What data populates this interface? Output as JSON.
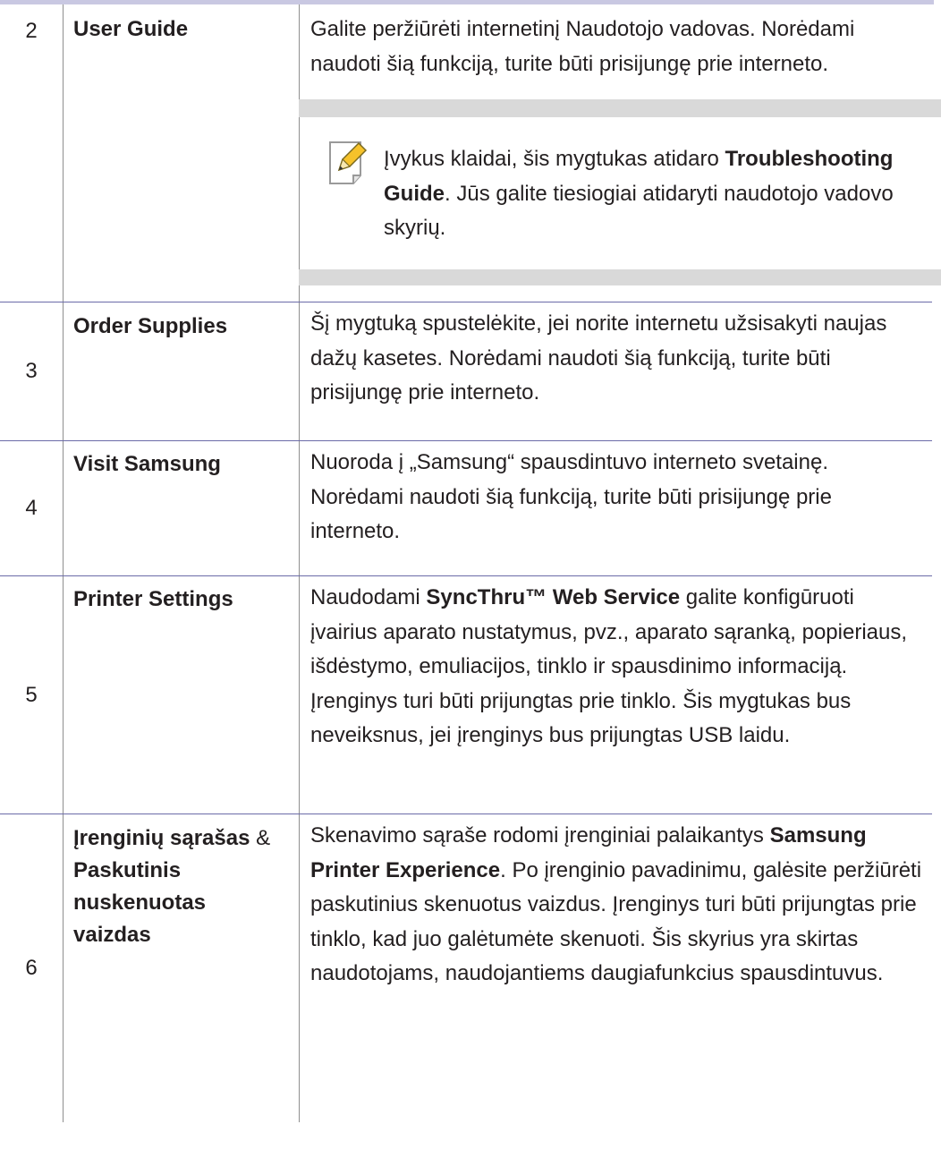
{
  "rows": [
    {
      "num": "2",
      "name": "User Guide",
      "desc": "Galite peržiūrėti internetinį Naudotojo vadovas. Norėdami naudoti šią funkciją, turite būti prisijungę prie interneto.",
      "note": {
        "pre": "Įvykus klaidai, šis mygtukas atidaro ",
        "bold": "Troubleshooting Guide",
        "post": ". Jūs galite tiesiogiai atidaryti naudotojo vadovo skyrių."
      }
    },
    {
      "num": "3",
      "name": "Order Supplies",
      "desc": "Šį mygtuką spustelėkite, jei norite internetu užsisakyti naujas dažų kasetes. Norėdami naudoti šią funkciją, turite būti prisijungę prie interneto."
    },
    {
      "num": "4",
      "name": "Visit Samsung",
      "desc": "Nuoroda į „Samsung“ spausdintuvo interneto svetainę. Norėdami naudoti šią funkciją, turite būti prisijungę prie interneto."
    },
    {
      "num": "5",
      "name": "Printer Settings",
      "desc_pre": "Naudodami ",
      "desc_bold": "SyncThru™ Web Service",
      "desc_post": " galite konfigūruoti įvairius aparato nustatymus, pvz., aparato sąranką, popieriaus, išdėstymo, emuliacijos, tinklo ir spausdinimo informaciją. Įrenginys turi būti prijungtas prie tinklo. Šis mygtukas bus neveiksnus, jei įrenginys bus prijungtas USB laidu."
    },
    {
      "num": "6",
      "name_a": "Įrenginių sąrašas",
      "name_amp": " & ",
      "name_b": "Paskutinis nuskenuotas vaizdas",
      "desc_pre": "Skenavimo sąraše rodomi įrenginiai palaikantys ",
      "desc_bold": "Samsung Printer Experience",
      "desc_post": ". Po įrenginio pavadinimu, galėsite peržiūrėti paskutinius skenuotus vaizdus. Įrenginys turi būti prijungtas prie tinklo, kad juo galėtumėte skenuoti. Šis skyrius yra skirtas naudotojams, naudojantiems daugiafunkcius spausdintuvus."
    }
  ],
  "icon": "note-pencil-icon"
}
